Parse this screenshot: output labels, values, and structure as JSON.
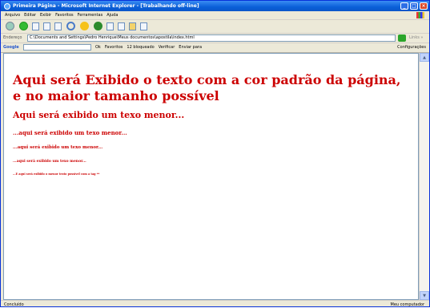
{
  "window": {
    "title": "Primeira Página - Microsoft Internet Explorer - [Trabalhando off-line]",
    "controls": [
      "_",
      "□",
      "×"
    ]
  },
  "menu": [
    "Arquivo",
    "Editar",
    "Exibir",
    "Favoritos",
    "Ferramentas",
    "Ajuda"
  ],
  "address": {
    "label": "Endereço",
    "url": "C:\\Documents and Settings\\Pedro Henrique\\Meus documentos\\apostila\\index.html",
    "links": "Links »"
  },
  "google_bar": {
    "brand": "Google",
    "items": [
      "Ok",
      "Favoritos",
      "12 bloqueado",
      "Verificar",
      "Enviar para",
      "Configurações"
    ]
  },
  "content": {
    "h1": "Aqui será Exibido o texto com a cor padrão da página, e no maior tamanho possível",
    "h2": "Aqui será exibido um texo menor...",
    "h3": "...aqui será exibido um texo menor...",
    "h4": "...aqui será exibido um texo menor...",
    "h5": "...aqui será exibido um texo menor...",
    "h6": "...E aqui será exibido o menor texto possível com a tag **"
  },
  "status": {
    "left": "Concluído",
    "right": "Meu computador"
  },
  "colors": {
    "text": "#cc0000",
    "titlebar": "#0a5fd8"
  }
}
